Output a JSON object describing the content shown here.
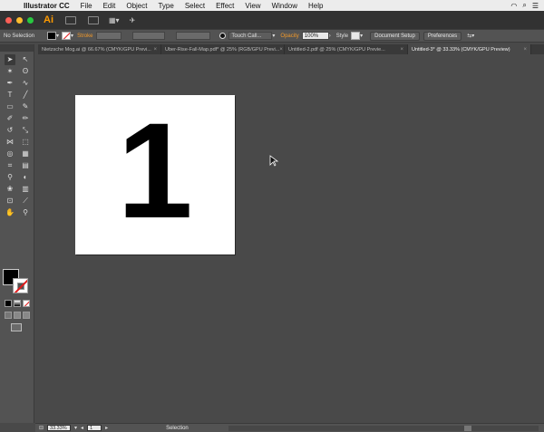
{
  "menubar": {
    "app_name": "Illustrator CC",
    "menus": [
      "File",
      "Edit",
      "Object",
      "Type",
      "Select",
      "Effect",
      "View",
      "Window",
      "Help"
    ]
  },
  "appbar": {
    "logo": "Ai"
  },
  "controlbar": {
    "selection_label": "No Selection",
    "stroke_label": "Stroke",
    "brush_value": "Touch Call...",
    "opacity_label": "Opacity",
    "opacity_value": "100%",
    "style_label": "Style",
    "document_setup": "Document Setup",
    "preferences": "Preferences"
  },
  "tabs": [
    {
      "label": "Nietzsche Mog.ai @ 66.67% (CMYK/GPU Previ...",
      "active": false
    },
    {
      "label": "Uber-Rise-Fall-Map.pdf* @ 25% (RGB/GPU Previ...",
      "active": false
    },
    {
      "label": "Untitled-2.pdf @ 25% (CMYK/GPU Previe...",
      "active": false
    },
    {
      "label": "Untitled-3* @ 33.33% (CMYK/GPU Preview)",
      "active": true
    }
  ],
  "artboard": {
    "content_text": "1"
  },
  "statusbar": {
    "zoom": "33.33%",
    "artboard_number": "1",
    "tool_label": "Selection"
  },
  "colors": {
    "accent": "#f39a2b",
    "canvas": "#494949",
    "panel": "#535353",
    "fill": "#000000",
    "stroke_none_slash": "#e21b1b"
  },
  "tool_icons": [
    "selection-tool-icon",
    "direct-selection-tool-icon",
    "magic-wand-tool-icon",
    "lasso-tool-icon",
    "pen-tool-icon",
    "curvature-tool-icon",
    "type-tool-icon",
    "line-tool-icon",
    "rectangle-tool-icon",
    "paintbrush-tool-icon",
    "shaper-tool-icon",
    "pencil-tool-icon",
    "rotate-tool-icon",
    "scale-tool-icon",
    "width-tool-icon",
    "free-transform-tool-icon",
    "shape-builder-tool-icon",
    "perspective-grid-tool-icon",
    "mesh-tool-icon",
    "gradient-tool-icon",
    "eyedropper-tool-icon",
    "blend-tool-icon",
    "symbol-sprayer-tool-icon",
    "graph-tool-icon",
    "artboard-tool-icon",
    "slice-tool-icon",
    "hand-tool-icon",
    "zoom-tool-icon"
  ]
}
